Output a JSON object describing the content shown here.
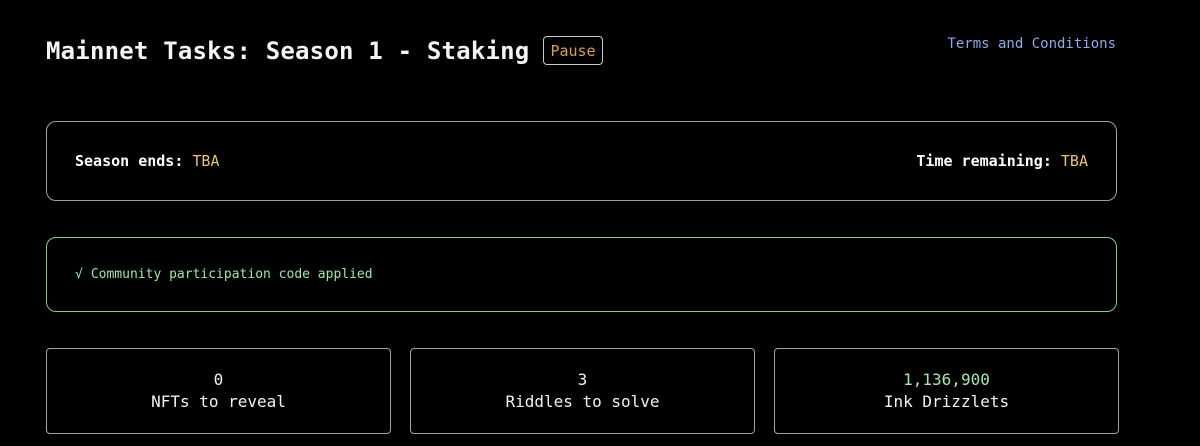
{
  "header": {
    "title": "Mainnet Tasks: Season 1 - Staking",
    "status_badge": "Pause",
    "terms_link": "Terms and Conditions"
  },
  "season": {
    "ends_label": "Season ends:",
    "ends_value": "TBA",
    "remaining_label": "Time remaining:",
    "remaining_value": "TBA"
  },
  "notice": {
    "icon": "check-icon",
    "check": "√",
    "text": "Community participation code applied"
  },
  "stats": [
    {
      "value": "0",
      "label": "NFTs to reveal"
    },
    {
      "value": "3",
      "label": "Riddles to solve"
    },
    {
      "value": "1,136,900",
      "label": "Ink Drizzlets"
    }
  ],
  "colors": {
    "badge": "#d9a04a",
    "link": "#8ea8e8",
    "highlight": "#e8c46d",
    "success": "#9fe6a4"
  }
}
